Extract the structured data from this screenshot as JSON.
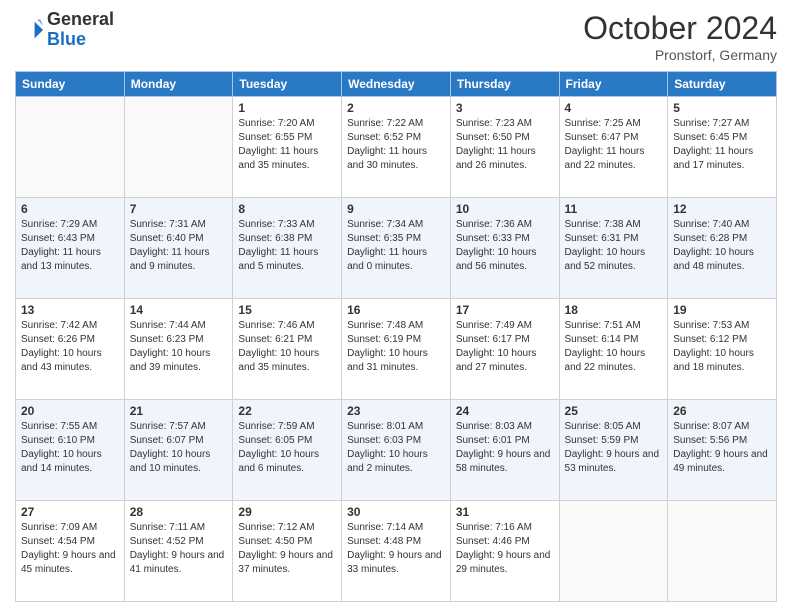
{
  "header": {
    "logo_general": "General",
    "logo_blue": "Blue",
    "month": "October 2024",
    "location": "Pronstorf, Germany"
  },
  "weekdays": [
    "Sunday",
    "Monday",
    "Tuesday",
    "Wednesday",
    "Thursday",
    "Friday",
    "Saturday"
  ],
  "weeks": [
    [
      {
        "day": "",
        "info": ""
      },
      {
        "day": "",
        "info": ""
      },
      {
        "day": "1",
        "info": "Sunrise: 7:20 AM\nSunset: 6:55 PM\nDaylight: 11 hours and 35 minutes."
      },
      {
        "day": "2",
        "info": "Sunrise: 7:22 AM\nSunset: 6:52 PM\nDaylight: 11 hours and 30 minutes."
      },
      {
        "day": "3",
        "info": "Sunrise: 7:23 AM\nSunset: 6:50 PM\nDaylight: 11 hours and 26 minutes."
      },
      {
        "day": "4",
        "info": "Sunrise: 7:25 AM\nSunset: 6:47 PM\nDaylight: 11 hours and 22 minutes."
      },
      {
        "day": "5",
        "info": "Sunrise: 7:27 AM\nSunset: 6:45 PM\nDaylight: 11 hours and 17 minutes."
      }
    ],
    [
      {
        "day": "6",
        "info": "Sunrise: 7:29 AM\nSunset: 6:43 PM\nDaylight: 11 hours and 13 minutes."
      },
      {
        "day": "7",
        "info": "Sunrise: 7:31 AM\nSunset: 6:40 PM\nDaylight: 11 hours and 9 minutes."
      },
      {
        "day": "8",
        "info": "Sunrise: 7:33 AM\nSunset: 6:38 PM\nDaylight: 11 hours and 5 minutes."
      },
      {
        "day": "9",
        "info": "Sunrise: 7:34 AM\nSunset: 6:35 PM\nDaylight: 11 hours and 0 minutes."
      },
      {
        "day": "10",
        "info": "Sunrise: 7:36 AM\nSunset: 6:33 PM\nDaylight: 10 hours and 56 minutes."
      },
      {
        "day": "11",
        "info": "Sunrise: 7:38 AM\nSunset: 6:31 PM\nDaylight: 10 hours and 52 minutes."
      },
      {
        "day": "12",
        "info": "Sunrise: 7:40 AM\nSunset: 6:28 PM\nDaylight: 10 hours and 48 minutes."
      }
    ],
    [
      {
        "day": "13",
        "info": "Sunrise: 7:42 AM\nSunset: 6:26 PM\nDaylight: 10 hours and 43 minutes."
      },
      {
        "day": "14",
        "info": "Sunrise: 7:44 AM\nSunset: 6:23 PM\nDaylight: 10 hours and 39 minutes."
      },
      {
        "day": "15",
        "info": "Sunrise: 7:46 AM\nSunset: 6:21 PM\nDaylight: 10 hours and 35 minutes."
      },
      {
        "day": "16",
        "info": "Sunrise: 7:48 AM\nSunset: 6:19 PM\nDaylight: 10 hours and 31 minutes."
      },
      {
        "day": "17",
        "info": "Sunrise: 7:49 AM\nSunset: 6:17 PM\nDaylight: 10 hours and 27 minutes."
      },
      {
        "day": "18",
        "info": "Sunrise: 7:51 AM\nSunset: 6:14 PM\nDaylight: 10 hours and 22 minutes."
      },
      {
        "day": "19",
        "info": "Sunrise: 7:53 AM\nSunset: 6:12 PM\nDaylight: 10 hours and 18 minutes."
      }
    ],
    [
      {
        "day": "20",
        "info": "Sunrise: 7:55 AM\nSunset: 6:10 PM\nDaylight: 10 hours and 14 minutes."
      },
      {
        "day": "21",
        "info": "Sunrise: 7:57 AM\nSunset: 6:07 PM\nDaylight: 10 hours and 10 minutes."
      },
      {
        "day": "22",
        "info": "Sunrise: 7:59 AM\nSunset: 6:05 PM\nDaylight: 10 hours and 6 minutes."
      },
      {
        "day": "23",
        "info": "Sunrise: 8:01 AM\nSunset: 6:03 PM\nDaylight: 10 hours and 2 minutes."
      },
      {
        "day": "24",
        "info": "Sunrise: 8:03 AM\nSunset: 6:01 PM\nDaylight: 9 hours and 58 minutes."
      },
      {
        "day": "25",
        "info": "Sunrise: 8:05 AM\nSunset: 5:59 PM\nDaylight: 9 hours and 53 minutes."
      },
      {
        "day": "26",
        "info": "Sunrise: 8:07 AM\nSunset: 5:56 PM\nDaylight: 9 hours and 49 minutes."
      }
    ],
    [
      {
        "day": "27",
        "info": "Sunrise: 7:09 AM\nSunset: 4:54 PM\nDaylight: 9 hours and 45 minutes."
      },
      {
        "day": "28",
        "info": "Sunrise: 7:11 AM\nSunset: 4:52 PM\nDaylight: 9 hours and 41 minutes."
      },
      {
        "day": "29",
        "info": "Sunrise: 7:12 AM\nSunset: 4:50 PM\nDaylight: 9 hours and 37 minutes."
      },
      {
        "day": "30",
        "info": "Sunrise: 7:14 AM\nSunset: 4:48 PM\nDaylight: 9 hours and 33 minutes."
      },
      {
        "day": "31",
        "info": "Sunrise: 7:16 AM\nSunset: 4:46 PM\nDaylight: 9 hours and 29 minutes."
      },
      {
        "day": "",
        "info": ""
      },
      {
        "day": "",
        "info": ""
      }
    ]
  ]
}
